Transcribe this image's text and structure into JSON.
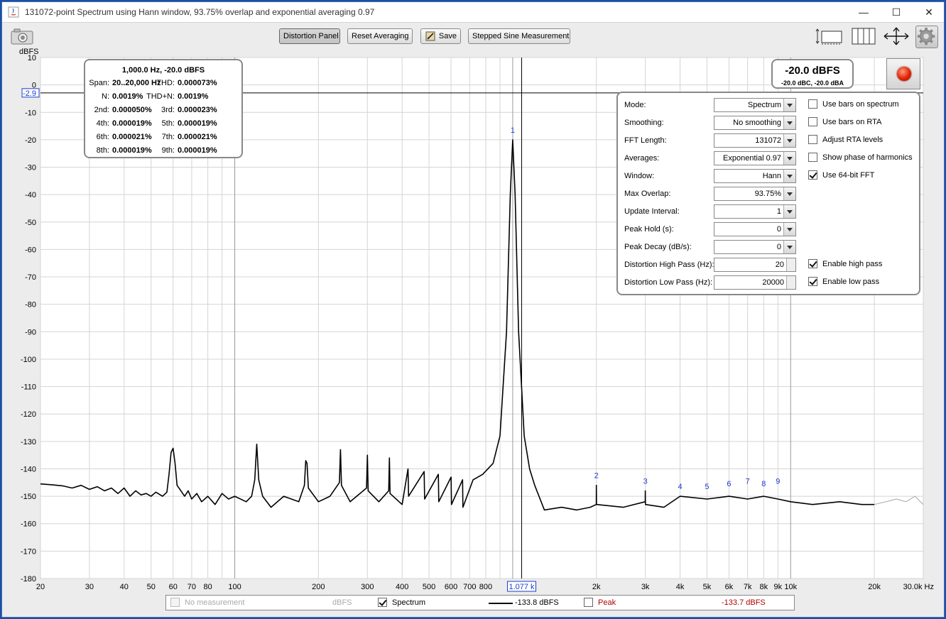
{
  "window": {
    "title": "131072-point Spectrum using Hann window, 93.75% overlap and exponential averaging 0.97",
    "min_glyph": "—",
    "max_glyph": "☐",
    "close_glyph": "✕"
  },
  "toolbar": {
    "distortion_label": "Distortion Panel",
    "reset_label": "Reset Averaging",
    "save_label": "Save",
    "stepped_label": "Stepped Sine Measurement",
    "icons": [
      "camera-icon",
      "bar-view-icon",
      "grid-view-icon",
      "arrows-icon",
      "gear-icon"
    ]
  },
  "stats": {
    "header": "1,000.0 Hz, -20.0 dBFS",
    "rows": [
      {
        "l1": "Span:",
        "v1": "20..20,000 Hz",
        "l2": "THD:",
        "v2": "0.000073%"
      },
      {
        "l1": "N:",
        "v1": "0.0019%",
        "l2": "THD+N:",
        "v2": "0.0019%"
      },
      {
        "l1": "2nd:",
        "v1": "0.000050%",
        "l2": "3rd:",
        "v2": "0.000023%"
      },
      {
        "l1": "4th:",
        "v1": "0.000019%",
        "l2": "5th:",
        "v2": "0.000019%"
      },
      {
        "l1": "6th:",
        "v1": "0.000021%",
        "l2": "7th:",
        "v2": "0.000021%"
      },
      {
        "l1": "8th:",
        "v1": "0.000019%",
        "l2": "9th:",
        "v2": "0.000019%"
      }
    ]
  },
  "level": {
    "main": "-20.0 dBFS",
    "sub": "-20.0 dBC, -20.0 dBA"
  },
  "settings": {
    "rows": [
      {
        "label": "Mode:",
        "value": "Spectrum",
        "kind": "combo"
      },
      {
        "label": "Smoothing:",
        "value": "No  smoothing",
        "kind": "combo"
      },
      {
        "label": "FFT Length:",
        "value": "131072",
        "kind": "combo"
      },
      {
        "label": "Averages:",
        "value": "Exponential 0.97",
        "kind": "combo"
      },
      {
        "label": "Window:",
        "value": "Hann",
        "kind": "combo"
      },
      {
        "label": "Max Overlap:",
        "value": "93.75%",
        "kind": "combo"
      },
      {
        "label": "Update Interval:",
        "value": "1",
        "kind": "combo"
      },
      {
        "label": "Peak Hold (s):",
        "value": "0",
        "kind": "combo"
      },
      {
        "label": "Peak Decay (dB/s):",
        "value": "0",
        "kind": "combo"
      },
      {
        "label": "Distortion High Pass (Hz):",
        "value": "20",
        "kind": "spin"
      },
      {
        "label": "Distortion Low Pass (Hz):",
        "value": "20000",
        "kind": "spin"
      }
    ],
    "checks": [
      {
        "label": "Use bars on spectrum",
        "checked": false,
        "row": 0
      },
      {
        "label": "Use bars on RTA",
        "checked": false,
        "row": 1
      },
      {
        "label": "Adjust RTA levels",
        "checked": false,
        "row": 2
      },
      {
        "label": "Show phase of harmonics",
        "checked": false,
        "row": 3
      },
      {
        "label": "Use 64-bit FFT",
        "checked": true,
        "row": 4
      },
      {
        "label": "Enable high pass",
        "checked": true,
        "row": 9
      },
      {
        "label": "Enable low pass",
        "checked": true,
        "row": 10
      }
    ]
  },
  "legend": {
    "items": [
      {
        "label": "No measurement",
        "unit": "dBFS",
        "checked": false,
        "disabled": true
      },
      {
        "label": "Spectrum",
        "value": "-133.8 dBFS",
        "checked": true,
        "color": "#000000"
      },
      {
        "label": "Peak",
        "value": "-133.7 dBFS",
        "checked": false,
        "color": "#b00000"
      }
    ]
  },
  "chart_data": {
    "type": "line",
    "y_unit": "dBFS",
    "x_scale": "log",
    "xlim": [
      20,
      30000
    ],
    "ylim": [
      -180,
      10
    ],
    "y_ticks": [
      10,
      0,
      -10,
      -20,
      -30,
      -40,
      -50,
      -60,
      -70,
      -80,
      -90,
      -100,
      -110,
      -120,
      -130,
      -140,
      -150,
      -160,
      -170,
      -180
    ],
    "x_ticks": [
      {
        "v": 20,
        "t": "20"
      },
      {
        "v": 30,
        "t": "30"
      },
      {
        "v": 40,
        "t": "40"
      },
      {
        "v": 50,
        "t": "50"
      },
      {
        "v": 60,
        "t": "60"
      },
      {
        "v": 70,
        "t": "70"
      },
      {
        "v": 80,
        "t": "80"
      },
      {
        "v": 100,
        "t": "100"
      },
      {
        "v": 200,
        "t": "200"
      },
      {
        "v": 300,
        "t": "300"
      },
      {
        "v": 400,
        "t": "400"
      },
      {
        "v": 500,
        "t": "500"
      },
      {
        "v": 600,
        "t": "600"
      },
      {
        "v": 700,
        "t": "700"
      },
      {
        "v": 800,
        "t": "800"
      },
      {
        "v": 2000,
        "t": "2k"
      },
      {
        "v": 3000,
        "t": "3k"
      },
      {
        "v": 4000,
        "t": "4k"
      },
      {
        "v": 5000,
        "t": "5k"
      },
      {
        "v": 6000,
        "t": "6k"
      },
      {
        "v": 7000,
        "t": "7k"
      },
      {
        "v": 8000,
        "t": "8k"
      },
      {
        "v": 9000,
        "t": "9k"
      },
      {
        "v": 10000,
        "t": "10k"
      },
      {
        "v": 20000,
        "t": "20k"
      },
      {
        "v": 30000,
        "t": "30.0k Hz"
      }
    ],
    "cursor": {
      "x": 1077,
      "x_label": "1.077 k",
      "y": -2.9,
      "y_label": "-2.9"
    },
    "harmonic_markers": [
      {
        "n": "1",
        "f": 1000,
        "db": -20
      },
      {
        "n": "2",
        "f": 2000,
        "db": -146
      },
      {
        "n": "3",
        "f": 3000,
        "db": -148
      },
      {
        "n": "4",
        "f": 4000,
        "db": -150
      },
      {
        "n": "5",
        "f": 5000,
        "db": -150
      },
      {
        "n": "6",
        "f": 6000,
        "db": -149
      },
      {
        "n": "7",
        "f": 7000,
        "db": -148
      },
      {
        "n": "8",
        "f": 8000,
        "db": -149
      },
      {
        "n": "9",
        "f": 9000,
        "db": -148
      }
    ],
    "series": [
      {
        "name": "Spectrum",
        "color": "#000000",
        "points": [
          [
            20,
            -145.5
          ],
          [
            22,
            -145.8
          ],
          [
            24,
            -146.2
          ],
          [
            26,
            -147
          ],
          [
            28,
            -146
          ],
          [
            30,
            -147.5
          ],
          [
            32,
            -146.5
          ],
          [
            34,
            -148
          ],
          [
            36,
            -147
          ],
          [
            38,
            -149
          ],
          [
            40,
            -147
          ],
          [
            42,
            -150
          ],
          [
            44,
            -148
          ],
          [
            46,
            -149.5
          ],
          [
            48,
            -149
          ],
          [
            50,
            -150
          ],
          [
            52,
            -148.5
          ],
          [
            55,
            -150
          ],
          [
            57,
            -148.5
          ],
          [
            58,
            -142
          ],
          [
            59,
            -134
          ],
          [
            60,
            -132.5
          ],
          [
            61,
            -138
          ],
          [
            62,
            -146
          ],
          [
            64,
            -148
          ],
          [
            66,
            -150
          ],
          [
            68,
            -148
          ],
          [
            70,
            -151
          ],
          [
            73,
            -149
          ],
          [
            76,
            -152
          ],
          [
            80,
            -150
          ],
          [
            85,
            -153
          ],
          [
            90,
            -149
          ],
          [
            95,
            -151
          ],
          [
            100,
            -150
          ],
          [
            110,
            -152
          ],
          [
            115,
            -150
          ],
          [
            118,
            -144
          ],
          [
            120,
            -131
          ],
          [
            122,
            -144
          ],
          [
            126,
            -150
          ],
          [
            135,
            -154
          ],
          [
            150,
            -150
          ],
          [
            170,
            -152
          ],
          [
            178,
            -146
          ],
          [
            180,
            -137
          ],
          [
            182,
            -138
          ],
          [
            184,
            -147
          ],
          [
            200,
            -152
          ],
          [
            220,
            -150
          ],
          [
            238,
            -145
          ],
          [
            240,
            -133
          ],
          [
            242,
            -146
          ],
          [
            260,
            -152
          ],
          [
            298,
            -147
          ],
          [
            300,
            -135
          ],
          [
            302,
            -148
          ],
          [
            330,
            -152
          ],
          [
            358,
            -148
          ],
          [
            360,
            -136
          ],
          [
            362,
            -149
          ],
          [
            400,
            -153
          ],
          [
            420,
            -140
          ],
          [
            422,
            -150
          ],
          [
            480,
            -141
          ],
          [
            482,
            -151
          ],
          [
            540,
            -142
          ],
          [
            542,
            -152
          ],
          [
            600,
            -143
          ],
          [
            602,
            -153
          ],
          [
            660,
            -144
          ],
          [
            662,
            -154
          ],
          [
            720,
            -144
          ],
          [
            780,
            -142
          ],
          [
            850,
            -138
          ],
          [
            900,
            -128
          ],
          [
            950,
            -90
          ],
          [
            980,
            -40
          ],
          [
            1000,
            -20
          ],
          [
            1020,
            -40
          ],
          [
            1050,
            -90
          ],
          [
            1100,
            -128
          ],
          [
            1150,
            -140
          ],
          [
            1200,
            -146
          ],
          [
            1300,
            -155
          ],
          [
            1500,
            -154
          ],
          [
            1700,
            -155
          ],
          [
            1900,
            -154
          ],
          [
            1998,
            -153
          ],
          [
            2000,
            -146
          ],
          [
            2002,
            -153
          ],
          [
            2500,
            -154
          ],
          [
            2998,
            -152
          ],
          [
            3000,
            -148
          ],
          [
            3002,
            -153
          ],
          [
            3500,
            -154
          ],
          [
            4000,
            -150
          ],
          [
            5000,
            -151
          ],
          [
            6000,
            -150
          ],
          [
            7000,
            -151
          ],
          [
            8000,
            -150
          ],
          [
            9000,
            -151
          ],
          [
            10000,
            -152
          ],
          [
            12000,
            -153
          ],
          [
            15000,
            -152
          ],
          [
            18000,
            -153
          ],
          [
            20000,
            -153
          ]
        ]
      },
      {
        "name": "",
        "color": "#b4b4b4",
        "points": [
          [
            20000,
            -153
          ],
          [
            22000,
            -152
          ],
          [
            24000,
            -151
          ],
          [
            26000,
            -152
          ],
          [
            28000,
            -150
          ],
          [
            30000,
            -153
          ]
        ]
      }
    ]
  }
}
